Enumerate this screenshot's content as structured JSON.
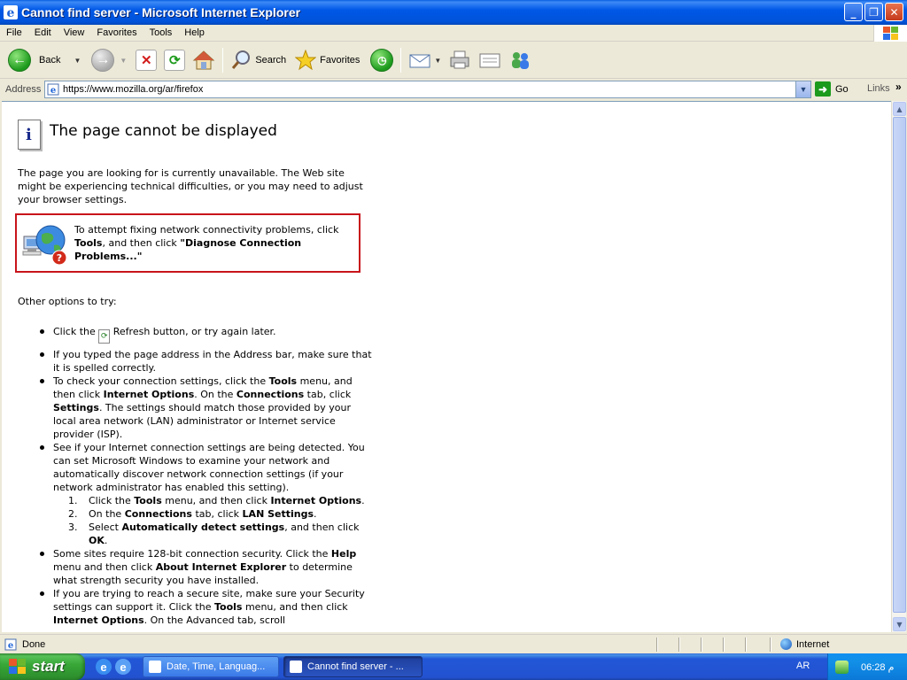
{
  "window": {
    "title": "Cannot find server - Microsoft Internet Explorer"
  },
  "menu": [
    "File",
    "Edit",
    "View",
    "Favorites",
    "Tools",
    "Help"
  ],
  "toolbar": {
    "back": "Back",
    "search": "Search",
    "favorites": "Favorites"
  },
  "address": {
    "label": "Address",
    "url": "https://www.mozilla.org/ar/firefox",
    "go": "Go",
    "links": "Links"
  },
  "page": {
    "heading": "The page cannot be displayed",
    "intro": "The page you are looking for is currently unavailable. The Web site might be experiencing technical difficulties, or you may need to adjust your browser settings.",
    "diag_part1": "To attempt fixing network connectivity problems, click",
    "diag_tools": "Tools",
    "diag_part2": ", and then click",
    "diag_bold": "\"Diagnose Connection Problems...\"",
    "other_heading": "Other options to try:",
    "opt1_a": "Click the",
    "opt1_b": "Refresh button, or try again later.",
    "opt2": "If you typed the page address in the Address bar, make sure that it is spelled correctly.",
    "opt3_a": "To check your connection settings, click the",
    "opt3_tools": "Tools",
    "opt3_b": "menu, and then click",
    "opt3_io": "Internet Options",
    "opt3_c": ". On the",
    "opt3_conn": "Connections",
    "opt3_d": "tab, click",
    "opt3_settings": "Settings",
    "opt3_e": ". The settings should match those provided by your local area network (LAN) administrator or Internet service provider (ISP).",
    "opt4": "See if your Internet connection settings are being detected. You can set Microsoft Windows to examine your network and automatically discover network connection settings (if your network administrator has enabled this setting).",
    "step1_num": "1.",
    "step1_a": "Click the",
    "step1_tools": "Tools",
    "step1_b": "menu, and then click",
    "step1_io": "Internet Options",
    "step2_num": "2.",
    "step2_a": "On the",
    "step2_conn": "Connections",
    "step2_b": "tab, click",
    "step2_lan": "LAN Settings",
    "step3_num": "3.",
    "step3_a": "Select",
    "step3_auto": "Automatically detect settings",
    "step3_b": ", and then click",
    "step3_ok": "OK",
    "opt5_a": "Some sites require 128-bit connection security. Click the",
    "opt5_help": "Help",
    "opt5_b": "menu and then click",
    "opt5_about": "About Internet Explorer",
    "opt5_c": "to determine what strength security you have installed.",
    "opt6_a": "If you are trying to reach a secure site, make sure your Security settings can support it. Click the",
    "opt6_tools": "Tools",
    "opt6_b": "menu, and then click",
    "opt6_io": "Internet Options",
    "opt6_c": ". On the Advanced tab, scroll"
  },
  "status": {
    "text": "Done",
    "zone": "Internet"
  },
  "taskbar": {
    "start": "start",
    "task1": "Date, Time, Languag...",
    "task2": "Cannot find server - ...",
    "lang": "AR",
    "clock": "06:28 م"
  },
  "colors": {
    "titlebar": "#0058e6",
    "diag_border": "#c8141b",
    "taskbar": "#2352d0",
    "start": "#38a838"
  }
}
